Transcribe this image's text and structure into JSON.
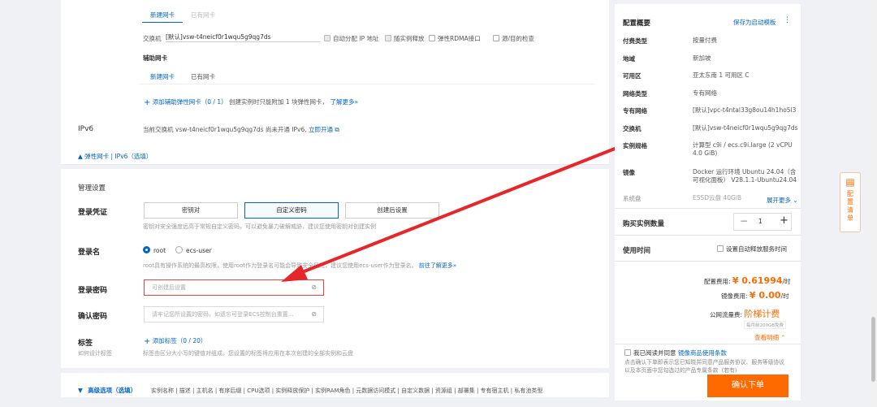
{
  "nic": {
    "tabs": [
      "新建网卡",
      "已有网卡"
    ],
    "switch_label": "交换机",
    "switch_value": "[默认]vsw-t4neicf0r1wqu5g9qg7ds",
    "options": [
      "自动分配 IP 地址",
      "随实例释放",
      "弹性RDMA接口",
      "源/目的检查"
    ],
    "aux_title": "辅助网卡",
    "aux_tabs": [
      "新建网卡",
      "已有网卡"
    ],
    "add_aux_label": "添加辅助弹性网卡（0 / 1）",
    "add_aux_hint": "创建实例时只能附加 1 块弹性网卡，",
    "learn_more": "了解更多»"
  },
  "ipv6": {
    "label": "IPv6",
    "text": "当前交换机 vsw-t4neicf0r1wqu5g9qg7ds 尚未开通 IPv6,",
    "link": "立即开通"
  },
  "collapse_label": "弹性网卡 | IPv6（选填）",
  "mgmt": {
    "title": "管理设置",
    "cred_label": "登录凭证",
    "cred_options": [
      "密钥对",
      "自定义密码",
      "创建后设置"
    ],
    "cred_hint": "密钥对安全强度远高于常规自定义密码，可以避免暴力破解威胁，建议您使用密钥对创建实例",
    "login_name_label": "登录名",
    "login_names": [
      "root",
      "ecs-user"
    ],
    "login_hint": "root具有操作系统的最高权限，使用root作为登录名可能会导致安全风险，建议您使用ecs-user作为登录名。",
    "login_hint_link": "前往了解更多»",
    "pwd_label": "登录密码",
    "pwd_placeholder": "可创建后设置",
    "confirm_label": "确认密码",
    "confirm_placeholder": "请牢记您所设置的密码，如遗忘可登录ECS控制台重置...",
    "tag_label": "标签",
    "tag_sub": "如何设计标签",
    "add_tag": "添加标签（0 / 20）",
    "tag_hint": "标签由区分大小写的键值对组成。您设置的标签将应用在本次创建的全部实例和云盘"
  },
  "advanced": {
    "title": "高级选项（选填）",
    "items": "实例名称 | 描述 | 主机名 | 有序后缀 | CPU选项 | 实例释放保护 | 实例RAM角色 | 元数据访问模式 | 自定义数据 | 资源组 | 部署集 | 专有宿主机 | 私有池类型"
  },
  "summary": {
    "title": "配置概要",
    "save_template": "保存为启动模板",
    "rows": [
      {
        "k": "付费类型",
        "v": "按量付费"
      },
      {
        "k": "地域",
        "v": "新加坡"
      },
      {
        "k": "可用区",
        "v": "亚太东南 1 可用区 C"
      },
      {
        "k": "网络类型",
        "v": "专有网络"
      },
      {
        "k": "专有网络",
        "v": "[默认]vpc-t4ntal33g8ou14h1ho5l3"
      },
      {
        "k": "交换机",
        "v": "[默认]vsw-t4neicf0r1wqu5g9qg7ds"
      },
      {
        "k": "实例规格",
        "v": "计算型 c9i / ecs.c9i.large (2 vCPU 4.0 GiB)"
      },
      {
        "k": "镜像",
        "v": "Docker 运行环境 Ubuntu 24.04（含可视化面板） V28.1.1-Ubuntu24.04"
      },
      {
        "k": "系统盘",
        "v": "ESSD云盘 40GiB"
      }
    ],
    "expand_more": "展开更多",
    "qty_label": "购买实例数量",
    "qty_value": "1",
    "duration_label": "使用时间",
    "auto_release": "设置自动释放服务时间",
    "config_fee_label": "配置费用:",
    "config_fee": "¥ 0.61994",
    "per_hour": "/时",
    "image_fee_label": "镜像费用:",
    "image_fee": "¥ 0.00",
    "traffic_label": "公网流量费:",
    "traffic_value": "阶梯计费",
    "traffic_note": "每月前200GB免费",
    "view_detail": "查看明细",
    "agree_prefix": "我已阅读并同意",
    "agree_link": "镜像商品使用条款",
    "agree_note": "点击确认下单即表示您已知晓并同意产品服务协议、服务等级协议以及本页面中您勾选过的产品专属条款（若有）",
    "buy_button": "确认下单"
  },
  "side_tab": "配置清单"
}
